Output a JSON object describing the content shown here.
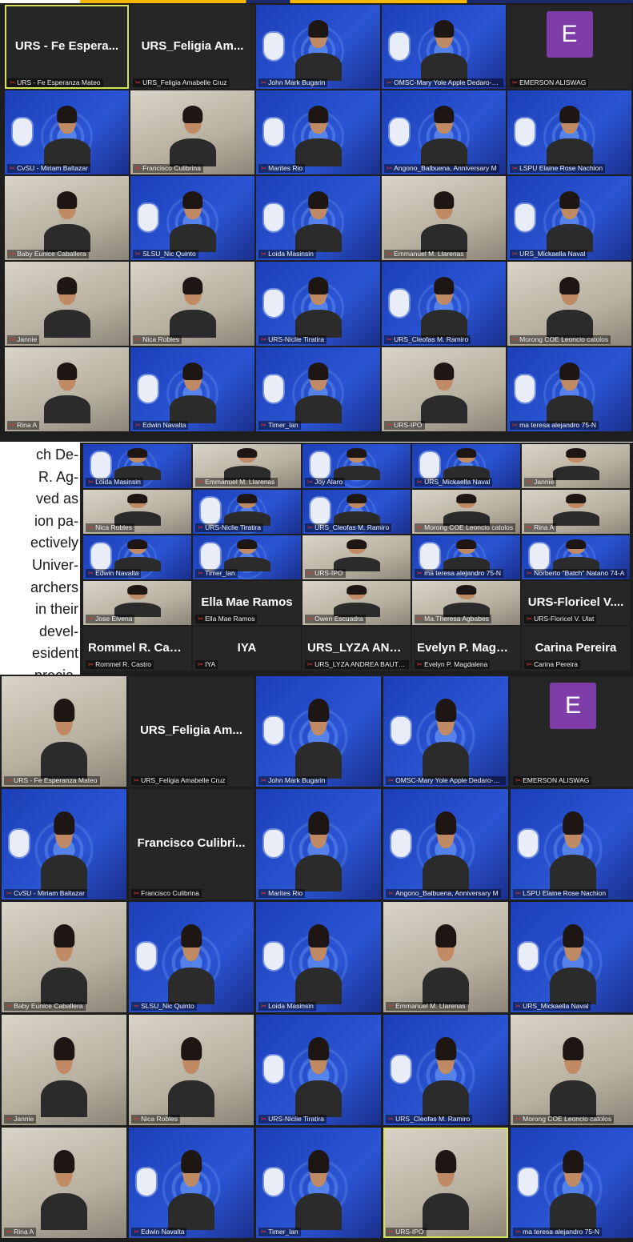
{
  "colors": {
    "accent_border": "#d6e05a",
    "mic_muted": "#e53935",
    "avatar_e": "#7e3da7",
    "dark_bg": "#1e1e1e"
  },
  "panel1": {
    "tiles": [
      {
        "big": "URS - Fe Espera...",
        "caption": "URS - Fe Esperanza Mateo"
      },
      {
        "big": "URS_Feligia Am...",
        "caption": "URS_Feligia Amabelle Cruz"
      },
      {
        "caption": "John Mark Bugarin"
      },
      {
        "caption": "OMSC-Mary Yole Apple Dedaro-Ruedas"
      },
      {
        "avatar": "E",
        "caption": "EMERSON ALISWAG"
      },
      {
        "caption": "CvSU - Miriam Baltazar"
      },
      {
        "caption": "Francisco Culibrina"
      },
      {
        "caption": "Marites Rio"
      },
      {
        "caption": "Angono_Balbuena, Anniversary M"
      },
      {
        "caption": "LSPU Elaine Rose Nachion"
      },
      {
        "caption": "Baby Eunice Caballera"
      },
      {
        "caption": "SLSU_Nic Quinto"
      },
      {
        "caption": "Loida Masinsin"
      },
      {
        "caption": "Emmanuel M. Llarenas"
      },
      {
        "caption": "URS_Mickaella Naval"
      },
      {
        "caption": "Jannie"
      },
      {
        "caption": "Nica Robles"
      },
      {
        "caption": "URS-Niclie Tiratira"
      },
      {
        "caption": "URS_Cleofas M. Ramiro"
      },
      {
        "caption": "Morong COE Leoncio catolos"
      },
      {
        "caption": "Rina A"
      },
      {
        "caption": "Edwin Navalta"
      },
      {
        "caption": "Timer_lan"
      },
      {
        "caption": "URS-IPO"
      },
      {
        "caption": "ma teresa alejandro 75-N"
      }
    ]
  },
  "panel2": {
    "tiles": [
      {
        "caption": "Loida Masinsin"
      },
      {
        "caption": "Emmanuel M. Llarenas"
      },
      {
        "caption": "Joy Alaro"
      },
      {
        "caption": "URS_Mickaella Naval"
      },
      {
        "caption": "Jannie"
      },
      {
        "caption": "Nica Robles"
      },
      {
        "caption": "URS-Niclie Tiratira"
      },
      {
        "caption": "URS_Cleofas M. Ramiro"
      },
      {
        "caption": "Morong COE Leoncio catolos"
      },
      {
        "caption": "Rina A"
      },
      {
        "caption": "Edwin Navalta"
      },
      {
        "caption": "Timer_lan"
      },
      {
        "caption": "URS-IPO"
      },
      {
        "caption": "ma teresa alejandro 75-N"
      },
      {
        "caption": "Norberto \"Batch\" Natano 74-A"
      },
      {
        "caption": "Jose Elvena"
      },
      {
        "big": "Ella Mae Ramos",
        "caption": "Ella Mae Ramos"
      },
      {
        "caption": "Owen Escuadra"
      },
      {
        "caption": "Ma.Theresa Agbabes"
      },
      {
        "big": "URS-Floricel V....",
        "caption": "URS-Floricel V. Ulat"
      },
      {
        "big": "Rommel R. Castro",
        "caption": "Rommel R. Castro"
      },
      {
        "big": "IYA",
        "caption": "IYA"
      },
      {
        "big": "URS_LYZA AND...",
        "caption": "URS_LYZA ANDREA BAUTISTA"
      },
      {
        "big": "Evelyn P. Magda...",
        "caption": "Evelyn P. Magdalena"
      },
      {
        "big": "Carina Pereira",
        "caption": "Carina Pereira"
      }
    ]
  },
  "panel3": {
    "tiles": [
      {
        "caption": "URS - Fe Esperanza Mateo"
      },
      {
        "big": "URS_Feligia Am...",
        "caption": "URS_Feligia Amabelle Cruz"
      },
      {
        "caption": "John Mark Bugarin"
      },
      {
        "caption": "OMSC-Mary Yole Apple Dedaro-Ruedas"
      },
      {
        "avatar": "E",
        "caption": "EMERSON ALISWAG"
      },
      {
        "caption": "CvSU - Miriam Baltazar"
      },
      {
        "big": "Francisco Culibri...",
        "caption": "Francisco Culibrina"
      },
      {
        "caption": "Marites Rio"
      },
      {
        "caption": "Angono_Balbuena, Anniversary M"
      },
      {
        "caption": "LSPU Elaine Rose Nachion"
      },
      {
        "caption": "Baby Eunice Caballera"
      },
      {
        "caption": "SLSU_Nic Quinto"
      },
      {
        "caption": "Loida Masinsin"
      },
      {
        "caption": "Emmanuel M. Llarenas"
      },
      {
        "caption": "URS_Mickaella Naval"
      },
      {
        "caption": "Jannie"
      },
      {
        "caption": "Nica Robles"
      },
      {
        "caption": "URS-Niclie Tiratira"
      },
      {
        "caption": "URS_Cleofas M. Ramiro"
      },
      {
        "caption": "Morong COE Leoncio catolos"
      },
      {
        "caption": "Rina A"
      },
      {
        "caption": "Edwin Navalta"
      },
      {
        "caption": "Timer_lan"
      },
      {
        "caption": "URS-IPO"
      },
      {
        "caption": "ma teresa alejandro 75-N"
      }
    ]
  },
  "text_snippet": [
    "ch De-",
    "R. Ag-",
    "ved as",
    "ion pa-",
    "ectively",
    "Univer-",
    "archers",
    "in their",
    "devel-",
    "esident",
    "precia-"
  ]
}
